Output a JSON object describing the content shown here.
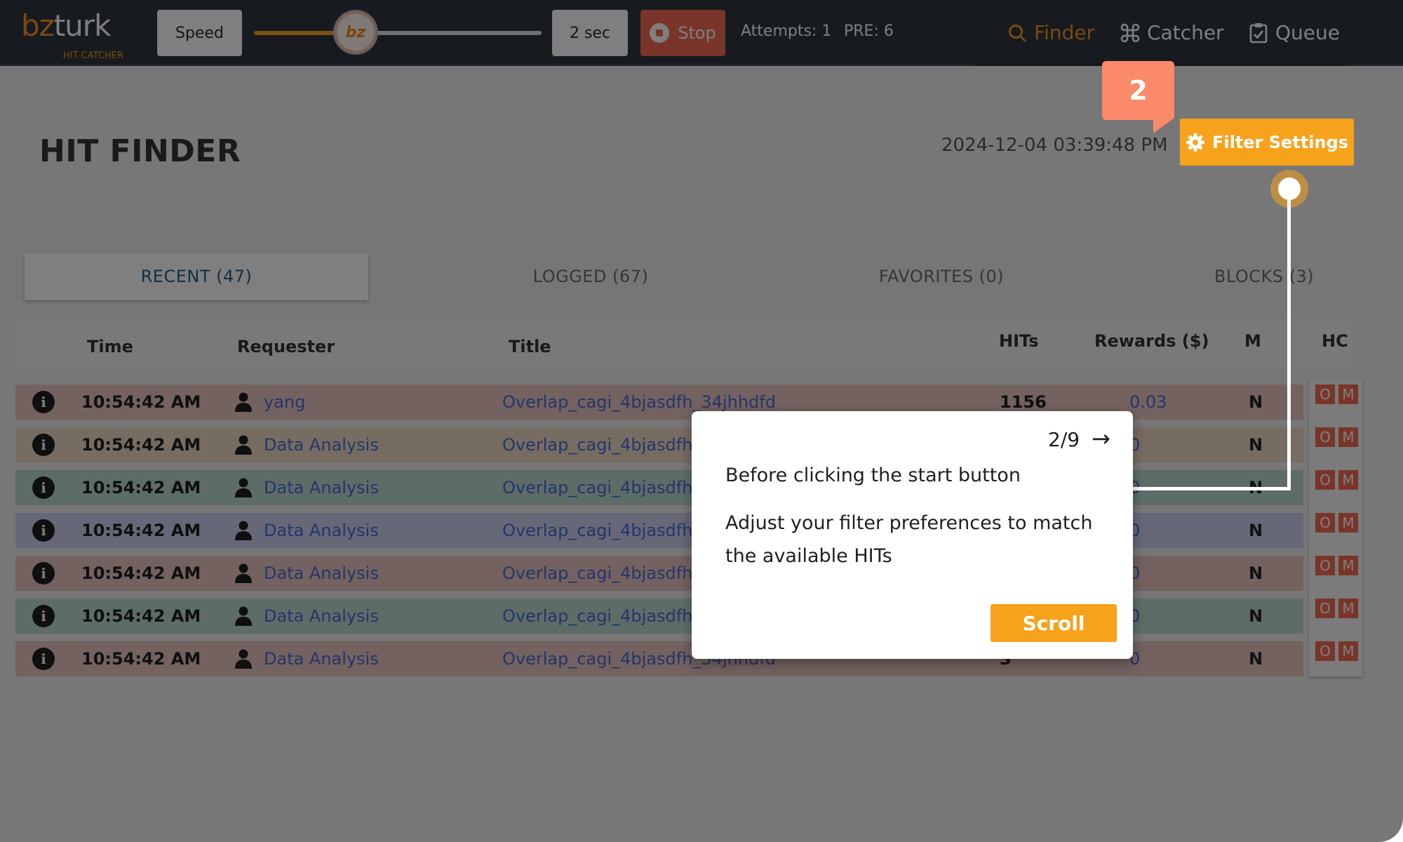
{
  "brand": {
    "logo_bz": "bz",
    "logo_turk": "turk",
    "subtitle": "HIT CATCHER",
    "accent": "#f7931e"
  },
  "toolbar": {
    "speed_label": "Speed",
    "slider_thumb_label": "bz",
    "slider_level": 0.3,
    "interval_label": "2 sec",
    "stop_label": "Stop",
    "attempts": "Attempts: 1",
    "pre": "PRE: 6"
  },
  "nav": {
    "finder": "Finder",
    "catcher": "Catcher",
    "queue": "Queue"
  },
  "header": {
    "title": "HIT FINDER",
    "datetime": "2024-12-04 03:39:48 PM",
    "filter_button": "Filter Settings"
  },
  "tabs": {
    "recent": "RECENT (47)",
    "logged": "LOGGED (67)",
    "favorites": "FAVORITES (0)",
    "blocks": "BLOCKS (3)"
  },
  "table": {
    "headers": {
      "time": "Time",
      "requester": "Requester",
      "title": "Title",
      "hits": "HITs",
      "rewards": "Rewards ($)",
      "m": "M",
      "hc": "HC"
    },
    "hc_buttons": {
      "o": "O",
      "m": "M"
    },
    "info_glyph": "i",
    "rows": [
      {
        "time": "10:54:42 AM",
        "requester": "yang",
        "title": "Overlap_cagi_4bjasdfh_34jhhdfd",
        "hits": "1156",
        "reward": "0.03",
        "m": "N",
        "color": "#e6c4bf"
      },
      {
        "time": "10:54:42 AM",
        "requester": "Data Analysis",
        "title": "Overlap_cagi_4bjasdfh_34jhhdfd",
        "hits": "",
        "reward": "0",
        "m": "N",
        "color": "#eed8c2"
      },
      {
        "time": "10:54:42 AM",
        "requester": "Data Analysis",
        "title": "Overlap_cagi_4bjasdfh_34jhhdfd",
        "hits": "",
        "reward": "0",
        "m": "N",
        "color": "#bcd8d1"
      },
      {
        "time": "10:54:42 AM",
        "requester": "Data Analysis",
        "title": "Overlap_cagi_4bjasdfh_34jhhdfd",
        "hits": "",
        "reward": "0",
        "m": "N",
        "color": "#cdd0ee"
      },
      {
        "time": "10:54:42 AM",
        "requester": "Data Analysis",
        "title": "Overlap_cagi_4bjasdfh_34jhhdfd",
        "hits": "",
        "reward": "0",
        "m": "N",
        "color": "#e6c4bf"
      },
      {
        "time": "10:54:42 AM",
        "requester": "Data Analysis",
        "title": "Overlap_cagi_4bjasdfh_34jhhdfd",
        "hits": "",
        "reward": "0",
        "m": "N",
        "color": "#bcd8d1"
      },
      {
        "time": "10:54:42 AM",
        "requester": "Data Analysis",
        "title": "Overlap_cagi_4bjasdfh_34jhhdfd",
        "hits": "3",
        "reward": "0",
        "m": "N",
        "color": "#e6c4bf"
      }
    ]
  },
  "tour": {
    "step_badge": "2",
    "progress": "2/9",
    "next_arrow": "→",
    "heading": "Before clicking the start button",
    "body": "Adjust your filter preferences to match the available HITs",
    "scroll_button": "Scroll"
  }
}
